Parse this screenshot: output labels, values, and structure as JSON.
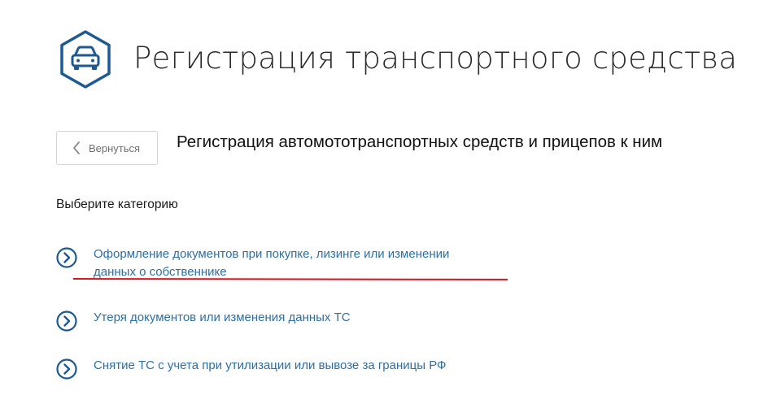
{
  "header": {
    "icon": "car-hexagon-icon",
    "title": "Регистрация транспортного средства"
  },
  "back_button": {
    "icon": "chevron-left-icon",
    "label": "Вернуться"
  },
  "section": {
    "title": "Регистрация автомототранспортных средств и прицепов к ним"
  },
  "categories": {
    "heading": "Выберите категорию",
    "items": [
      {
        "icon": "circle-chevron-right-icon",
        "label_line1": "Оформление документов при покупке, лизинге или изменении",
        "label_line2": "данных о собственнике"
      },
      {
        "icon": "circle-chevron-right-icon",
        "label": "Утеря документов или изменения данных ТС"
      },
      {
        "icon": "circle-chevron-right-icon",
        "label": "Снятие ТС с учета при утилизации или вывозе за границы РФ"
      }
    ]
  },
  "colors": {
    "accent_blue": "#2d6fa5",
    "icon_blue": "#1d5a94",
    "annotation_red": "#d4141e"
  }
}
